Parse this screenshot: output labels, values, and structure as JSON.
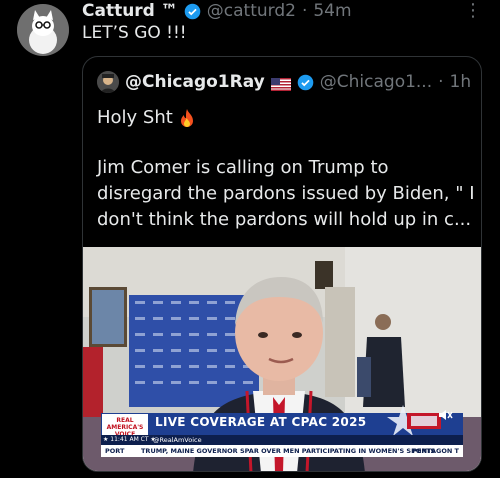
{
  "tweet": {
    "name": "Catturd ™",
    "handle": "@catturd2",
    "separator": "·",
    "time": "54m",
    "more": "⋮",
    "text": "LET’S GO !!!"
  },
  "quote": {
    "name": "@Chicago1Ray",
    "handle": "@Chicago1...",
    "separator": "·",
    "time": "1h",
    "line1": "Holy Sht",
    "body": "Jim Comer is calling on Trump to disregard the pardons issued by Biden, \" I don't think the pardons will hold up in c..."
  },
  "video": {
    "logo_line1": "REAL",
    "logo_line2": "AMERICA'S",
    "logo_line3": "VOICE",
    "live_text": "LIVE COVERAGE AT CPAC 2025",
    "clock": "★ 11:41 AM CT ★",
    "channel_handle": "@RealAmVoice",
    "ticker_left": "PORT",
    "ticker_main": "TRUMP, MAINE GOVERNOR SPAR OVER MEN PARTICIPATING IN WOMEN'S SPORTS",
    "ticker_right": "PENTAGON T"
  },
  "colors": {
    "background": "#000000",
    "text": "#e7e9ea",
    "muted": "#71767b",
    "verified": "#1d9bf0",
    "border": "#2f3336",
    "rav_blue": "#1e3f91"
  }
}
